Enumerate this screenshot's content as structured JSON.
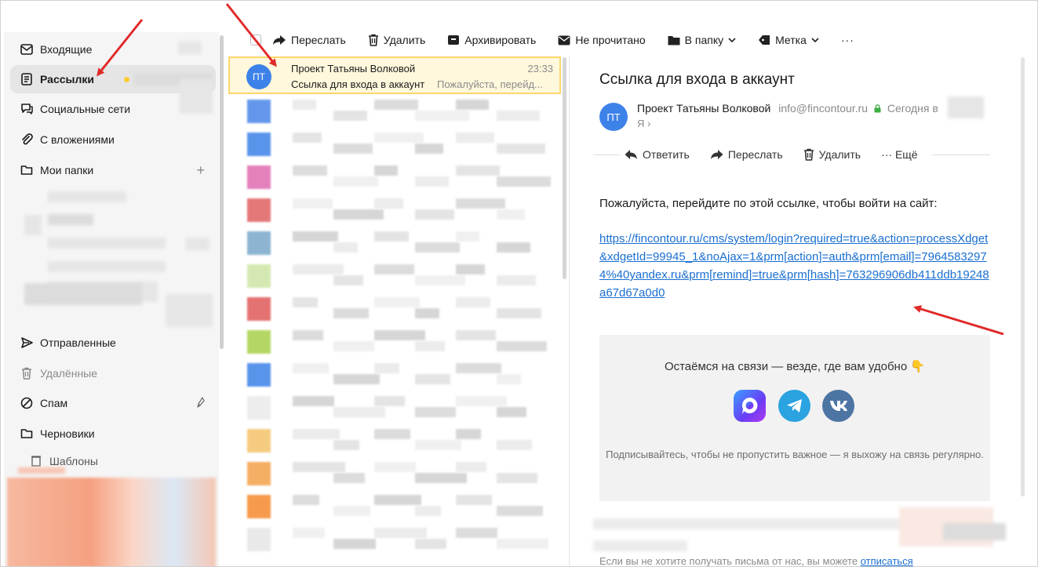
{
  "sidebar": {
    "folders": [
      {
        "label": "Входящие",
        "icon": "inbox-icon"
      },
      {
        "label": "Рассылки",
        "icon": "newsletter-icon"
      },
      {
        "label": "Социальные сети",
        "icon": "chat-icon"
      },
      {
        "label": "С вложениями",
        "icon": "paperclip-icon"
      },
      {
        "label": "Мои папки",
        "icon": "folder-icon"
      },
      {
        "label": "Отправленные",
        "icon": "send-icon"
      },
      {
        "label": "Удалённые",
        "icon": "trash-icon"
      },
      {
        "label": "Спам",
        "icon": "spam-icon"
      },
      {
        "label": "Черновики",
        "icon": "draft-icon"
      },
      {
        "label": "Шаблоны",
        "icon": "template-icon"
      }
    ],
    "add_symbol": "+"
  },
  "toolbar": {
    "forward": "Переслать",
    "delete": "Удалить",
    "archive": "Архивировать",
    "unread": "Не прочитано",
    "move": "В папку",
    "label": "Метка",
    "more": "···"
  },
  "message_list": {
    "selected": {
      "initials": "ПТ",
      "sender": "Проект Татьяны Волковой",
      "time": "23:33",
      "subject": "Ссылка для входа в аккаунт",
      "snippet": "Пожалуйста, перейд..."
    }
  },
  "message": {
    "subject": "Ссылка для входа в аккаунт",
    "initials": "ПТ",
    "from_name": "Проект Татьяны Волковой",
    "from_email": "info@fincontour.ru",
    "date": "Сегодня в",
    "to": "Я ›",
    "actions": {
      "reply": "Ответить",
      "forward": "Переслать",
      "delete": "Удалить",
      "more": "··· Ещё"
    },
    "body": "Пожалуйста, перейдите по этой ссылке, чтобы войти на сайт:",
    "link": "https://fincontour.ru/cms/system/login?required=true&action=processXdget&xdgetId=99945_1&noAjax=1&prm[action]=auth&prm[email]=79645832974%40yandex.ru&prm[remind]=true&prm[hash]=763296906db411ddb19248a67d67a0d0",
    "social_title": "Остаёмся на связи — везде, где вам удобно 👇",
    "social_note": "Подписывайтесь, чтобы не пропустить важное — я выхожу на связь регулярно.",
    "footer_text": "Если вы не хотите получать письма от нас, вы можете",
    "footer_link": "отписаться"
  },
  "colors": {
    "accent": "#3d82e8",
    "link": "#1a6fd1",
    "selected_row_bg": "#fff8dc",
    "selected_row_border": "#ffd66b",
    "arrow": "#e02a2a",
    "unread_dot": "#ffcc33"
  }
}
